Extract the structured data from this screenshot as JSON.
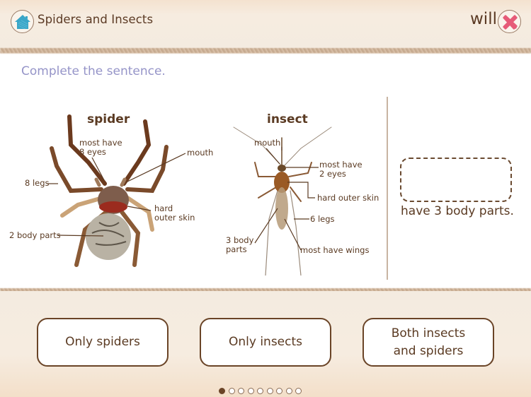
{
  "header": {
    "home_icon": "home-icon",
    "title": "Spiders and Insects",
    "word": "will",
    "close_icon": "close-x-icon",
    "accent_home": "#3aa6c8",
    "accent_close": "#e65b78"
  },
  "instruction": "Complete the sentence.",
  "spider": {
    "title": "spider",
    "labels": {
      "eyes": "most have\n8 eyes",
      "mouth": "mouth",
      "legs": "8 legs",
      "skin": "hard\nouter skin",
      "body": "2 body parts"
    }
  },
  "insect": {
    "title": "insect",
    "labels": {
      "mouth": "mouth",
      "eyes": "most have\n2 eyes",
      "skin": "hard outer skin",
      "legs": "6 legs",
      "body": "3 body\nparts",
      "wings": "most have wings"
    }
  },
  "sentence": {
    "blank": "",
    "rest": "have 3 body parts."
  },
  "choices": [
    {
      "label": "Only spiders"
    },
    {
      "label": "Only insects"
    },
    {
      "label": "Both insects\nand spiders"
    }
  ],
  "pagination": {
    "total": 9,
    "current": 1
  }
}
